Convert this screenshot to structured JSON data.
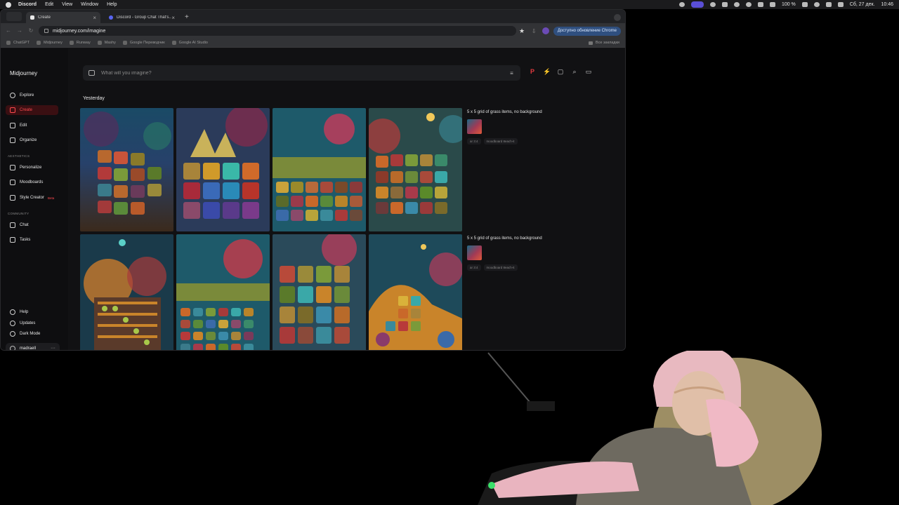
{
  "menubar": {
    "app": "Discord",
    "items": [
      "Edit",
      "View",
      "Window",
      "Help"
    ],
    "date": "Сб, 27 дек.",
    "time": "10:46",
    "battery": "100 %"
  },
  "tabs": [
    {
      "title": "Create",
      "active": true,
      "color": "#e8e8e8"
    },
    {
      "title": "Discord - Group Chat That's...",
      "active": false,
      "color": "#5865f2"
    }
  ],
  "address": {
    "url": "midjourney.com/imagine",
    "update_label": "Доступно обновление Chrome"
  },
  "bookmarks": {
    "items": [
      "ChatGPT",
      "Midjourney",
      "Runway",
      "Mashy",
      "Google Переводчик",
      "Google AI Studio"
    ],
    "all_label": "Все закладки"
  },
  "sidebar": {
    "logo": "Midjourney",
    "main": [
      {
        "label": "Explore",
        "icon": "compass-icon"
      },
      {
        "label": "Create",
        "icon": "brush-icon",
        "active": true
      },
      {
        "label": "Edit",
        "icon": "edit-icon"
      },
      {
        "label": "Organize",
        "icon": "grid-icon"
      }
    ],
    "aesthetics_header": "AESTHETICS",
    "aesthetics": [
      {
        "label": "Personalize",
        "icon": "personalize-icon"
      },
      {
        "label": "Moodboards",
        "icon": "moodboard-icon"
      },
      {
        "label": "Style Creator",
        "icon": "style-icon",
        "badge": "Beta"
      }
    ],
    "community_header": "COMMUNITY",
    "community": [
      {
        "label": "Chat",
        "icon": "chat-icon"
      },
      {
        "label": "Tasks",
        "icon": "tasks-icon"
      }
    ],
    "bottom": [
      {
        "label": "Help",
        "icon": "help-icon"
      },
      {
        "label": "Updates",
        "icon": "bell-icon"
      },
      {
        "label": "Dark Mode",
        "icon": "moon-icon"
      }
    ],
    "user": "madraell"
  },
  "search": {
    "placeholder": "What will you imagine?"
  },
  "feed": {
    "day_label": "Yesterday",
    "jobs": [
      {
        "prompt": "5 x 5 grid of grass items, no background",
        "tags": [
          "ar 3:4",
          "moodboard 8each-it"
        ]
      },
      {
        "prompt": "5 x 5 grid of grass items, no background",
        "tags": [
          "ar 3:4",
          "moodboard 8each-it"
        ]
      }
    ]
  },
  "colors": {
    "accent": "#ff4a4f",
    "bg": "#111113",
    "sidebar": "#0e0e10"
  }
}
